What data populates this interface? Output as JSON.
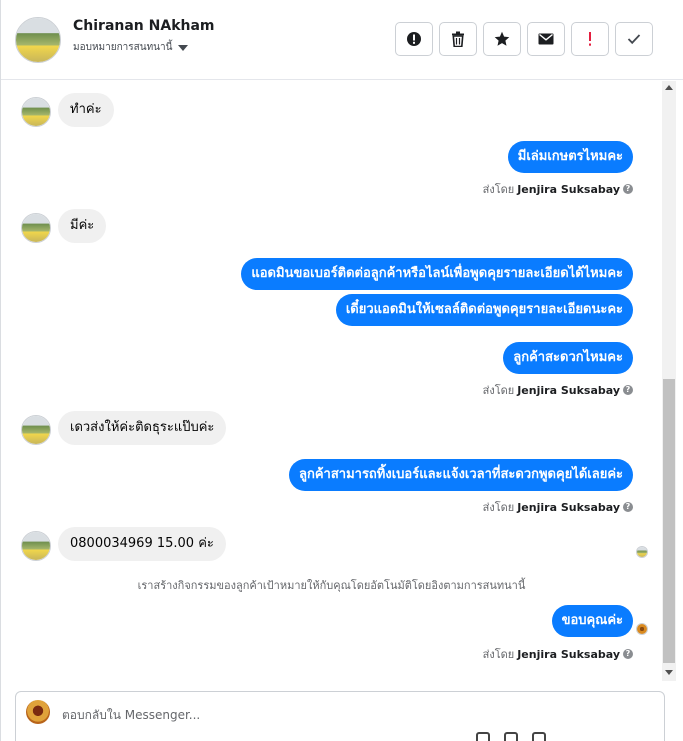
{
  "header": {
    "name": "Chiranan NAkham",
    "subtitle": "มอบหมายการสนทนานี้"
  },
  "actions": [
    {
      "icon": "alert-circle-icon"
    },
    {
      "icon": "trash-icon"
    },
    {
      "icon": "star-icon"
    },
    {
      "icon": "mail-icon"
    },
    {
      "icon": "exclamation-icon",
      "color": "#e41e3f"
    },
    {
      "icon": "check-icon"
    }
  ],
  "messages": {
    "m1": "ทำค่ะ",
    "m2": "มีเล่มเกษตรไหมคะ",
    "m3": "มีค่ะ",
    "m4": "แอดมินขอเบอร์ติดต่อลูกค้าหรือไลน์เพื่อพูดคุยรายละเอียดได้ไหมคะ",
    "m5": "เดี๋ยวแอดมินให้เซลล์ติดต่อพูดคุยรายละเอียดนะคะ",
    "m6": "ลูกค้าสะดวกไหมคะ",
    "m7": "เดวส่งให้ค่ะติดธุระแป๊บค่ะ",
    "m8": "ลูกค้าสามารถทิ้งเบอร์และแจ้งเวลาที่สะดวกพูดคุยได้เลยค่ะ",
    "m9": "0800034969  15.00 ค่ะ",
    "m10": "ขอบคุณค่ะ"
  },
  "sent_by": {
    "prefix": "ส่งโดย",
    "name": "Jenjira Suksabay",
    "help": "?"
  },
  "system_note": "เราสร้างกิจกรรมของลูกค้าเป้าหมายให้กับคุณโดยอัตโนมัติโดยอิงตามการสนทนานี้",
  "composer": {
    "placeholder": "ตอบกลับใน Messenger..."
  },
  "colors": {
    "outgoing_bubble": "#0a7cff",
    "incoming_bubble": "#f0f0f0"
  }
}
